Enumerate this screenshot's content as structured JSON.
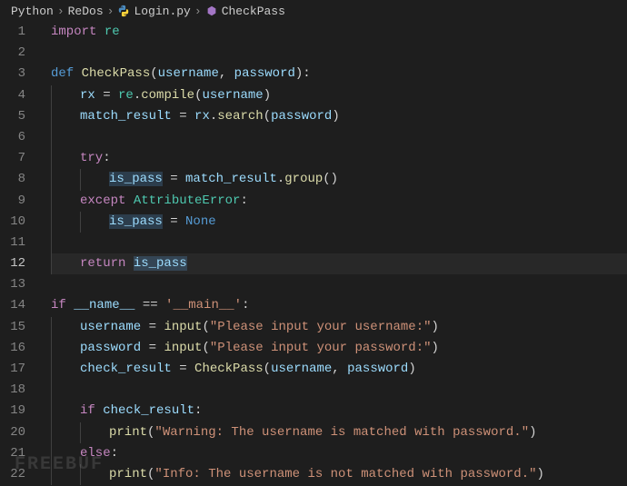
{
  "breadcrumb": {
    "items": [
      "Python",
      "ReDos",
      "Login.py",
      "CheckPass"
    ]
  },
  "editor": {
    "active_line": 12,
    "lines": [
      {
        "num": 1,
        "tokens": [
          {
            "t": "import ",
            "c": "kw"
          },
          {
            "t": "re",
            "c": "cls"
          }
        ]
      },
      {
        "num": 2,
        "tokens": []
      },
      {
        "num": 3,
        "tokens": [
          {
            "t": "def ",
            "c": "kw2"
          },
          {
            "t": "CheckPass",
            "c": "fn"
          },
          {
            "t": "(",
            "c": "punc"
          },
          {
            "t": "username",
            "c": "var"
          },
          {
            "t": ", ",
            "c": "punc"
          },
          {
            "t": "password",
            "c": "var"
          },
          {
            "t": "):",
            "c": "punc"
          }
        ]
      },
      {
        "num": 4,
        "indent": 1,
        "tokens": [
          {
            "t": "rx",
            "c": "var"
          },
          {
            "t": " = ",
            "c": "op"
          },
          {
            "t": "re",
            "c": "cls"
          },
          {
            "t": ".",
            "c": "punc"
          },
          {
            "t": "compile",
            "c": "fn"
          },
          {
            "t": "(",
            "c": "punc"
          },
          {
            "t": "username",
            "c": "var"
          },
          {
            "t": ")",
            "c": "punc"
          }
        ]
      },
      {
        "num": 5,
        "indent": 1,
        "tokens": [
          {
            "t": "match_result",
            "c": "var"
          },
          {
            "t": " = ",
            "c": "op"
          },
          {
            "t": "rx",
            "c": "var"
          },
          {
            "t": ".",
            "c": "punc"
          },
          {
            "t": "search",
            "c": "fn"
          },
          {
            "t": "(",
            "c": "punc"
          },
          {
            "t": "password",
            "c": "var"
          },
          {
            "t": ")",
            "c": "punc"
          }
        ]
      },
      {
        "num": 6,
        "indent": 1,
        "tokens": []
      },
      {
        "num": 7,
        "indent": 1,
        "tokens": [
          {
            "t": "try",
            "c": "kw"
          },
          {
            "t": ":",
            "c": "punc"
          }
        ]
      },
      {
        "num": 8,
        "indent": 2,
        "tokens": [
          {
            "t": "is_pass",
            "c": "var hlvar"
          },
          {
            "t": " = ",
            "c": "op"
          },
          {
            "t": "match_result",
            "c": "var"
          },
          {
            "t": ".",
            "c": "punc"
          },
          {
            "t": "group",
            "c": "fn"
          },
          {
            "t": "()",
            "c": "punc"
          }
        ]
      },
      {
        "num": 9,
        "indent": 1,
        "tokens": [
          {
            "t": "except ",
            "c": "kw"
          },
          {
            "t": "AttributeError",
            "c": "cls"
          },
          {
            "t": ":",
            "c": "punc"
          }
        ]
      },
      {
        "num": 10,
        "indent": 2,
        "tokens": [
          {
            "t": "is_pass",
            "c": "var hlvar"
          },
          {
            "t": " = ",
            "c": "op"
          },
          {
            "t": "None",
            "c": "const"
          }
        ]
      },
      {
        "num": 11,
        "indent": 1,
        "tokens": []
      },
      {
        "num": 12,
        "indent": 1,
        "tokens": [
          {
            "t": "return ",
            "c": "kw"
          },
          {
            "t": "is_pass",
            "c": "var hlvar"
          }
        ]
      },
      {
        "num": 13,
        "tokens": []
      },
      {
        "num": 14,
        "tokens": [
          {
            "t": "if ",
            "c": "kw"
          },
          {
            "t": "__name__",
            "c": "var"
          },
          {
            "t": " == ",
            "c": "op"
          },
          {
            "t": "'__main__'",
            "c": "str"
          },
          {
            "t": ":",
            "c": "punc"
          }
        ]
      },
      {
        "num": 15,
        "indent": 1,
        "tokens": [
          {
            "t": "username",
            "c": "var"
          },
          {
            "t": " = ",
            "c": "op"
          },
          {
            "t": "input",
            "c": "fn"
          },
          {
            "t": "(",
            "c": "punc"
          },
          {
            "t": "\"Please input your username:\"",
            "c": "str"
          },
          {
            "t": ")",
            "c": "punc"
          }
        ]
      },
      {
        "num": 16,
        "indent": 1,
        "tokens": [
          {
            "t": "password",
            "c": "var"
          },
          {
            "t": " = ",
            "c": "op"
          },
          {
            "t": "input",
            "c": "fn"
          },
          {
            "t": "(",
            "c": "punc"
          },
          {
            "t": "\"Please input your password:\"",
            "c": "str"
          },
          {
            "t": ")",
            "c": "punc"
          }
        ]
      },
      {
        "num": 17,
        "indent": 1,
        "tokens": [
          {
            "t": "check_result",
            "c": "var"
          },
          {
            "t": " = ",
            "c": "op"
          },
          {
            "t": "CheckPass",
            "c": "fn"
          },
          {
            "t": "(",
            "c": "punc"
          },
          {
            "t": "username",
            "c": "var"
          },
          {
            "t": ", ",
            "c": "punc"
          },
          {
            "t": "password",
            "c": "var"
          },
          {
            "t": ")",
            "c": "punc"
          }
        ]
      },
      {
        "num": 18,
        "indent": 1,
        "tokens": []
      },
      {
        "num": 19,
        "indent": 1,
        "tokens": [
          {
            "t": "if ",
            "c": "kw"
          },
          {
            "t": "check_result",
            "c": "var"
          },
          {
            "t": ":",
            "c": "punc"
          }
        ]
      },
      {
        "num": 20,
        "indent": 2,
        "tokens": [
          {
            "t": "print",
            "c": "fn"
          },
          {
            "t": "(",
            "c": "punc"
          },
          {
            "t": "\"Warning: The username is matched with password.\"",
            "c": "str"
          },
          {
            "t": ")",
            "c": "punc"
          }
        ]
      },
      {
        "num": 21,
        "indent": 1,
        "tokens": [
          {
            "t": "else",
            "c": "kw"
          },
          {
            "t": ":",
            "c": "punc"
          }
        ]
      },
      {
        "num": 22,
        "indent": 2,
        "tokens": [
          {
            "t": "print",
            "c": "fn"
          },
          {
            "t": "(",
            "c": "punc"
          },
          {
            "t": "\"Info: The username is not matched with password.\"",
            "c": "str"
          },
          {
            "t": ")",
            "c": "punc"
          }
        ]
      }
    ]
  },
  "watermark": "FREEBUF"
}
